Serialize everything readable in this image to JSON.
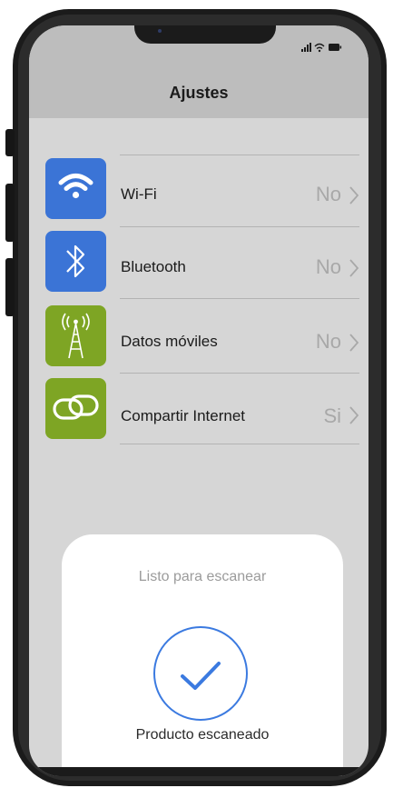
{
  "nav": {
    "title": "Ajustes"
  },
  "status_bar": {
    "icons": [
      "signal-icon",
      "wifi-icon",
      "battery-icon"
    ]
  },
  "settings": [
    {
      "label": "Wi-Fi",
      "value": "No",
      "icon": "wifi-icon",
      "color": "#3b74d6"
    },
    {
      "label": "Bluetooth",
      "value": "No",
      "icon": "bluetooth-icon",
      "color": "#3b74d6"
    },
    {
      "label": "Datos móviles",
      "value": "No",
      "icon": "cell-tower-icon",
      "color": "#7ea524"
    },
    {
      "label": "Compartir Internet",
      "value": "Si",
      "icon": "link-icon",
      "color": "#7ea524"
    }
  ],
  "scan": {
    "title": "Listo para escanear",
    "status": "Producto escaneado",
    "accent": "#3b7ae0"
  }
}
